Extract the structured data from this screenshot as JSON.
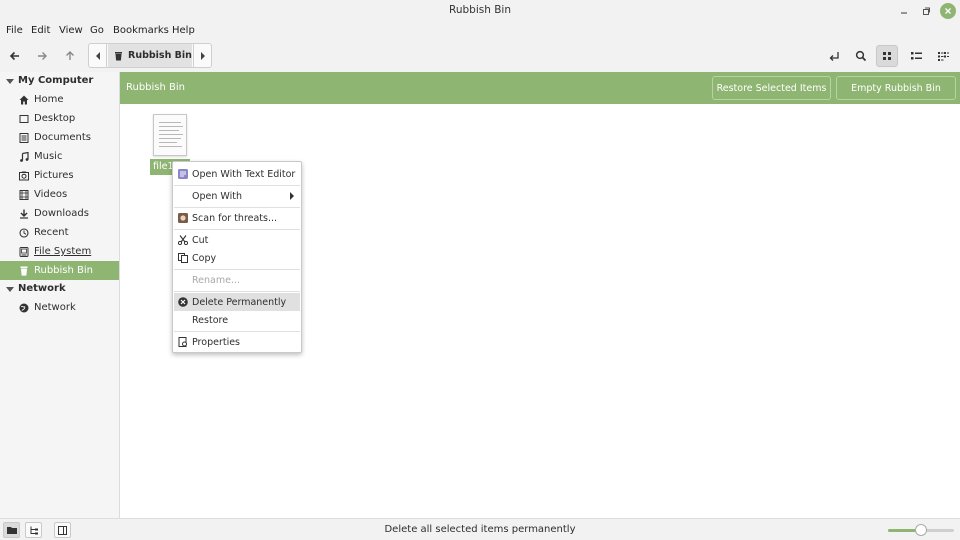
{
  "window": {
    "title": "Rubbish Bin"
  },
  "menu": [
    "File",
    "Edit",
    "View",
    "Go",
    "Bookmarks",
    "Help"
  ],
  "pathbar": {
    "current": "Rubbish Bin"
  },
  "sidebar": {
    "sections": [
      {
        "label": "My Computer",
        "items": [
          {
            "label": "Home",
            "icon": "home-icon"
          },
          {
            "label": "Desktop",
            "icon": "desktop-icon"
          },
          {
            "label": "Documents",
            "icon": "document-icon"
          },
          {
            "label": "Music",
            "icon": "music-icon"
          },
          {
            "label": "Pictures",
            "icon": "picture-icon"
          },
          {
            "label": "Videos",
            "icon": "video-icon"
          },
          {
            "label": "Downloads",
            "icon": "download-icon"
          },
          {
            "label": "Recent",
            "icon": "recent-icon"
          },
          {
            "label": "File System",
            "icon": "drive-icon"
          },
          {
            "label": "Rubbish Bin",
            "icon": "trash-icon",
            "selected": true
          }
        ]
      },
      {
        "label": "Network",
        "items": [
          {
            "label": "Network",
            "icon": "network-icon"
          }
        ]
      }
    ]
  },
  "banner": {
    "label": "Rubbish Bin",
    "restore_button": "Restore Selected Items",
    "empty_button": "Empty Rubbish Bin"
  },
  "file": {
    "name": "file1"
  },
  "context_menu": {
    "items": [
      {
        "label": "Open With Text Editor"
      },
      {
        "label": "Open With"
      },
      {
        "label": "Scan for threats..."
      },
      {
        "label": "Cut"
      },
      {
        "label": "Copy"
      },
      {
        "label": "Rename..."
      },
      {
        "label": "Delete Permanently"
      },
      {
        "label": "Restore"
      },
      {
        "label": "Properties"
      }
    ]
  },
  "statusbar": {
    "text": "Delete all selected items permanently"
  },
  "zoom": {
    "level": 0.5
  },
  "colors": {
    "accent": "#8fb573"
  }
}
